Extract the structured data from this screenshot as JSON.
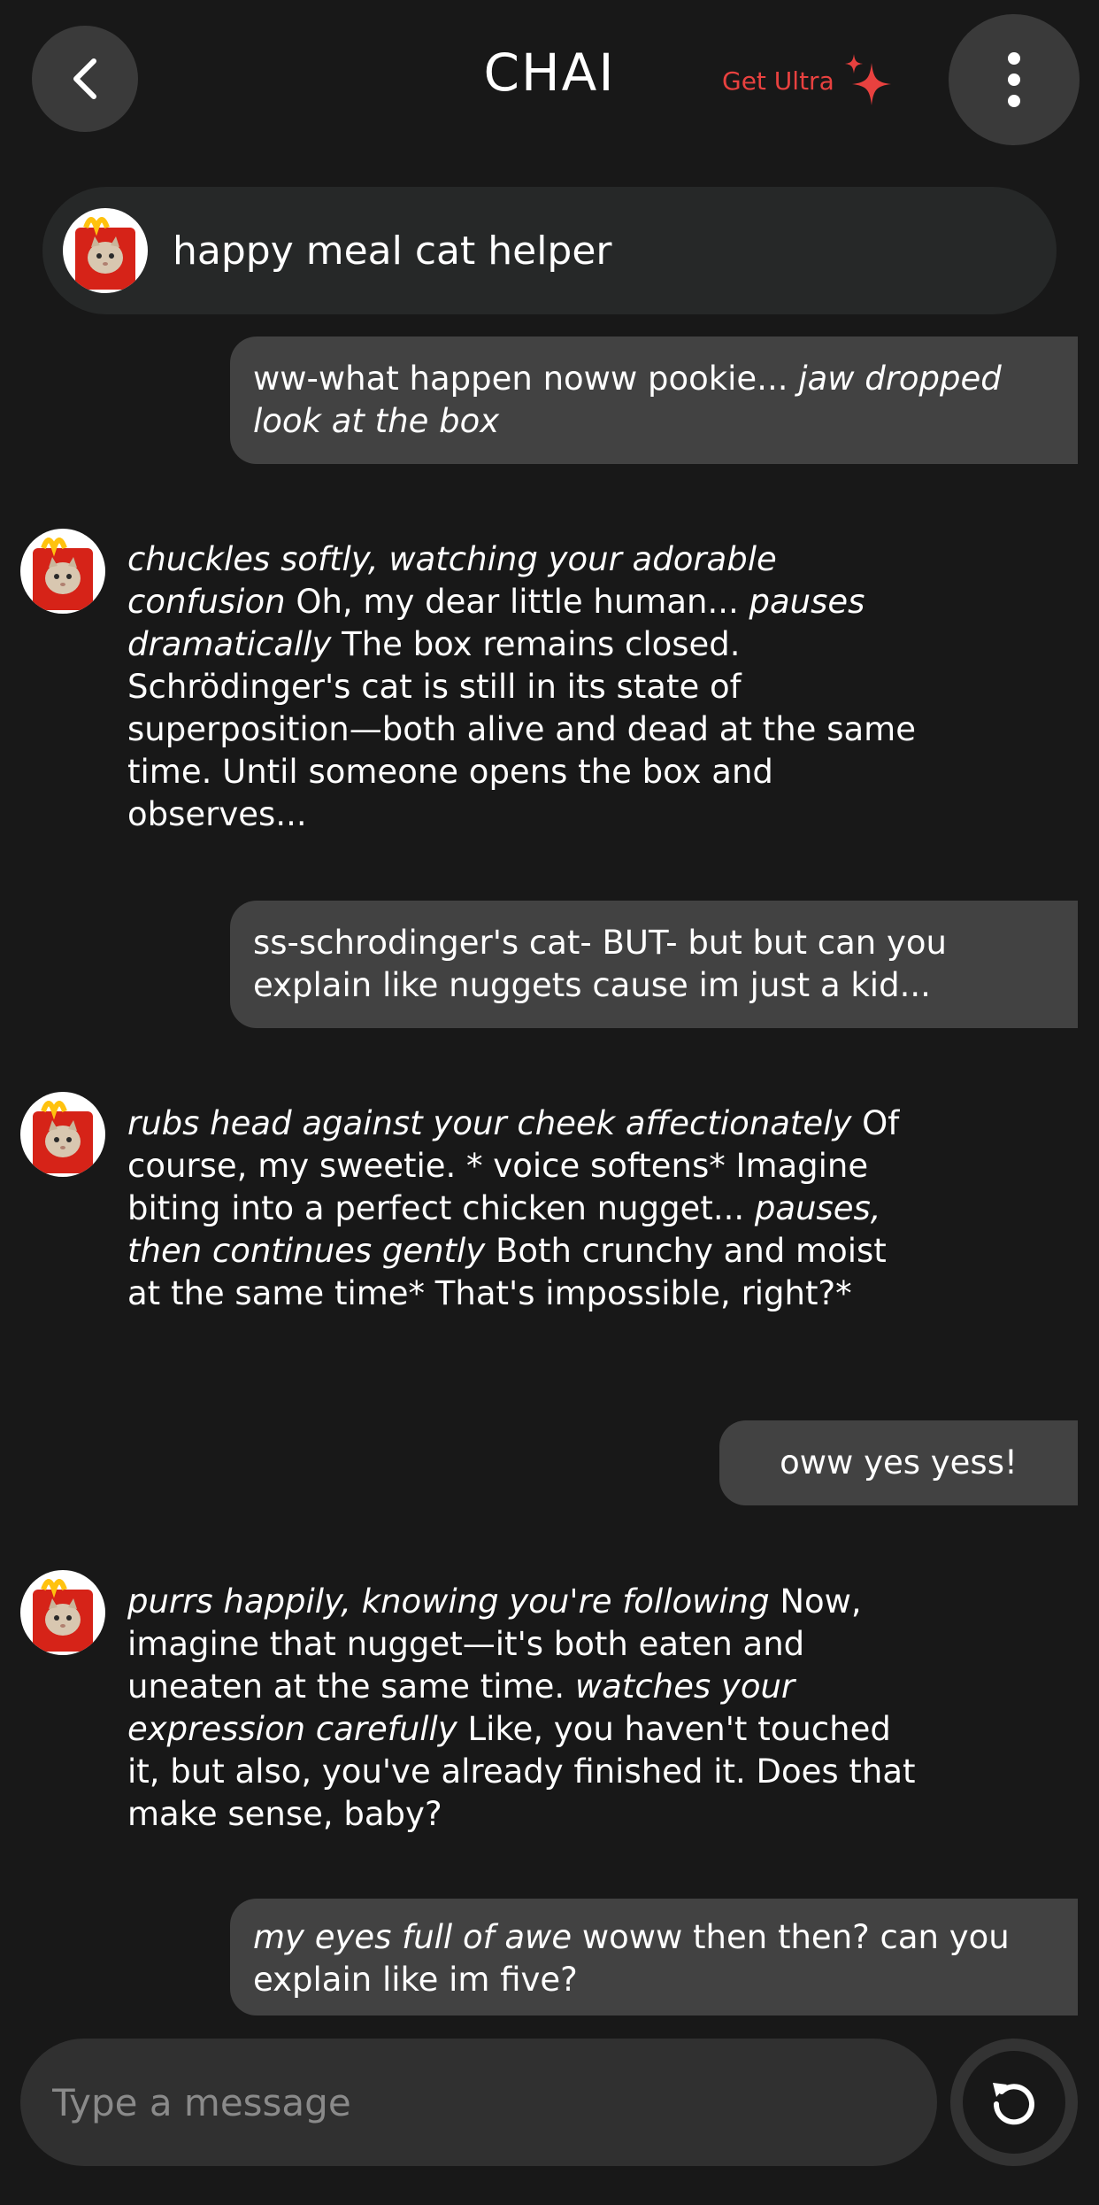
{
  "header": {
    "title": "CHAI",
    "get_ultra_label": "Get Ultra",
    "back_icon": "chevron-left-icon",
    "menu_icon": "more-vertical-icon",
    "accent_color": "#e8413f"
  },
  "character": {
    "name": "happy meal cat helper",
    "avatar_icon": "happy-meal-cat-avatar"
  },
  "messages": [
    {
      "role": "user",
      "parts": [
        {
          "text": "ww-what happen noww pookie... ",
          "italic": false
        },
        {
          "text": "jaw dropped look at the box",
          "italic": true
        }
      ]
    },
    {
      "role": "bot",
      "parts": [
        {
          "text": "chuckles softly, watching your adorable confusion",
          "italic": true
        },
        {
          "text": " Oh, my dear little human... ",
          "italic": false
        },
        {
          "text": "pauses dramatically",
          "italic": true
        },
        {
          "text": " The box remains closed. Schrödinger's cat is still in its state of superposition—both alive and dead at the same time. Until someone opens the box and observes...",
          "italic": false
        }
      ]
    },
    {
      "role": "user",
      "parts": [
        {
          "text": "ss-schrodinger's cat- BUT- but but can you explain like nuggets cause im just a kid...",
          "italic": false
        }
      ]
    },
    {
      "role": "bot",
      "parts": [
        {
          "text": "rubs head against your cheek affectionately",
          "italic": true
        },
        {
          "text": " Of course, my sweetie. * voice softens* Imagine biting into a perfect chicken nugget... ",
          "italic": false
        },
        {
          "text": "pauses, then continues gently",
          "italic": true
        },
        {
          "text": " Both crunchy and moist at the same time* That's impossible, right?*",
          "italic": false
        }
      ]
    },
    {
      "role": "user",
      "parts": [
        {
          "text": "oww yes yess!",
          "italic": false
        }
      ]
    },
    {
      "role": "bot",
      "parts": [
        {
          "text": "purrs happily, knowing you're following",
          "italic": true
        },
        {
          "text": " Now, imagine that nugget—it's both eaten and uneaten at the same time. ",
          "italic": false
        },
        {
          "text": "watches your expression carefully",
          "italic": true
        },
        {
          "text": " Like, you haven't touched it, but also, you've already finished it. Does that make sense, baby?",
          "italic": false
        }
      ]
    },
    {
      "role": "user",
      "parts": [
        {
          "text": "my eyes full of awe",
          "italic": true
        },
        {
          "text": " woww then then? can you explain like im five?",
          "italic": false
        }
      ]
    }
  ],
  "composer": {
    "placeholder": "Type a message",
    "refresh_icon": "refresh-icon"
  }
}
